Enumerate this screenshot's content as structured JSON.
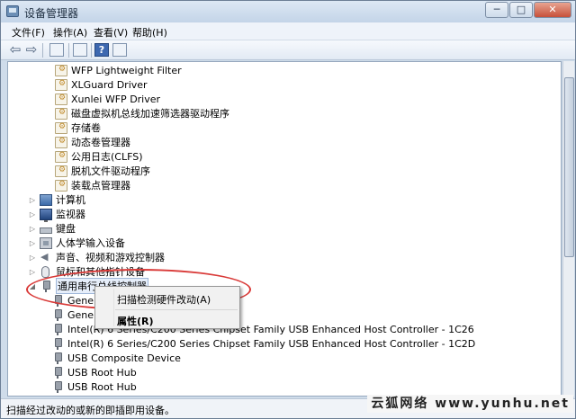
{
  "window": {
    "title": "设备管理器",
    "controls": {
      "minimize": "─",
      "maximize": "□",
      "close": "✕"
    }
  },
  "menubar": [
    {
      "label": "文件(F)"
    },
    {
      "label": "操作(A)"
    },
    {
      "label": "查看(V)"
    },
    {
      "label": "帮助(H)"
    }
  ],
  "toolbar": {
    "icons": [
      "back-arrow-icon",
      "forward-arrow-icon",
      "properties-icon",
      "update-driver-icon",
      "help-icon",
      "show-hidden-icon"
    ],
    "back_glyph": "⇦",
    "forward_glyph": "⇨",
    "help_glyph": "?"
  },
  "tree": {
    "driver_items": [
      "WFP Lightweight Filter",
      "XLGuard Driver",
      "Xunlei WFP Driver",
      "磁盘虚拟机总线加速筛选器驱动程序",
      "存储卷",
      "动态卷管理器",
      "公用日志(CLFS)",
      "脱机文件驱动程序",
      "装载点管理器"
    ],
    "categories": [
      {
        "label": "计算机",
        "icon": "computer-icon"
      },
      {
        "label": "监视器",
        "icon": "monitor-icon"
      },
      {
        "label": "键盘",
        "icon": "keyboard-icon"
      },
      {
        "label": "人体学输入设备",
        "icon": "hid-icon"
      },
      {
        "label": "声音、视频和游戏控制器",
        "icon": "speaker-icon"
      },
      {
        "label": "鼠标和其他指针设备",
        "icon": "mouse-icon"
      }
    ],
    "usb_category": {
      "label": "通用串行总线控制器",
      "icon": "usb-icon"
    },
    "usb_children": [
      "Gener",
      "Gener",
      "Intel(R) 6 Series/C200 Series Chipset Family USB Enhanced Host Controller - 1C26",
      "Intel(R) 6 Series/C200 Series Chipset Family USB Enhanced Host Controller - 1C2D",
      "USB Composite Device",
      "USB Root Hub",
      "USB Root Hub"
    ],
    "expand_glyph": "▷",
    "collapse_glyph": "◢"
  },
  "context_menu": {
    "scan": "扫描检测硬件改动(A)",
    "properties": "属性(R)"
  },
  "status": {
    "text": "扫描经过改动的或新的即插即用设备。"
  },
  "watermark": "云狐网络 www.yunhu.net",
  "colors": {
    "annotation": "#d93a38",
    "titlebar": "#c3d4e8"
  }
}
